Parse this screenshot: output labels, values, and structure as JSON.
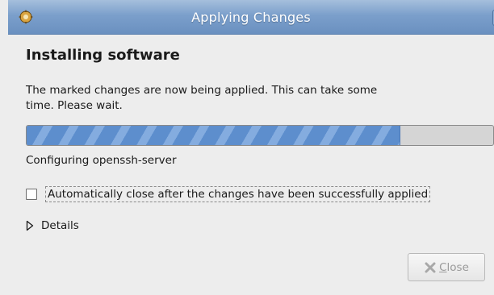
{
  "window": {
    "title": "Applying Changes",
    "app_icon": "package-manager-icon",
    "close_icon": "window-close-icon"
  },
  "content": {
    "heading": "Installing software",
    "description": "The marked changes are now being applied. This can take some time. Please wait.",
    "progress": 0.8,
    "status": "Configuring openssh-server"
  },
  "options": {
    "auto_close_label": "Automatically close after the changes have been successfully applied",
    "auto_close_checked": false
  },
  "details": {
    "label": "Details",
    "expanded": false
  },
  "buttons": {
    "close": {
      "mnemonic": "C",
      "rest": "lose",
      "enabled": false,
      "icon": "close-x-icon"
    }
  },
  "colors": {
    "titlebar": "#7b9fcb",
    "progress_fill": "#5d8ecd",
    "background": "#ededed"
  }
}
